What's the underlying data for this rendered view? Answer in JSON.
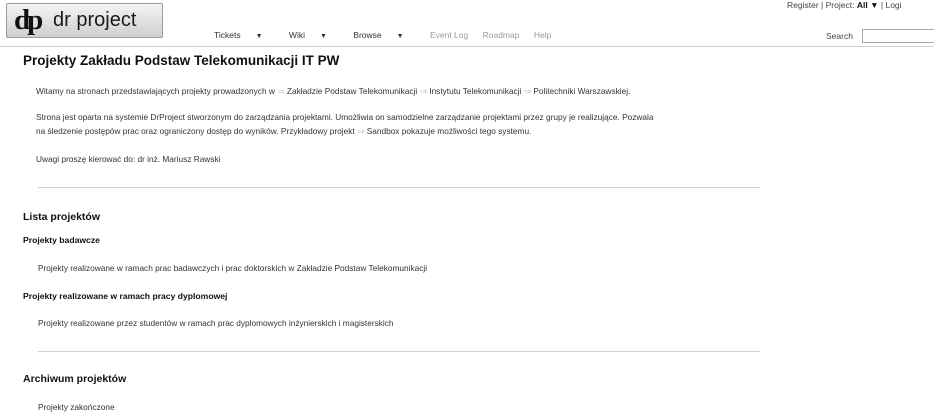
{
  "header": {
    "logo_mark": "dp",
    "logo_text": "dr project",
    "nav": [
      {
        "label": "Tickets",
        "dropdown": true
      },
      {
        "label": "Wiki",
        "dropdown": true
      },
      {
        "label": "Browse",
        "dropdown": true
      },
      {
        "label": "Event Log",
        "dropdown": false
      },
      {
        "label": "Roadmap",
        "dropdown": false
      },
      {
        "label": "Help",
        "dropdown": false
      }
    ],
    "register_label": "Register",
    "separator": "|",
    "project_label": "Project:",
    "project_value": "All",
    "login_label": "Logi",
    "search_label": "Search",
    "search_value": ""
  },
  "page": {
    "title": "Projekty Zakładu Podstaw Telekomunikacji IT PW",
    "intro": {
      "text_before": "Witamy na stronach przedstawiających projekty prowadzonych w",
      "link1": "Zakładzie Podstaw Telekomunikacji",
      "link2": "Instytutu Telekomunikacji",
      "link3": "Politechniki Warszawskiej."
    },
    "desc_line1": "Strona jest oparta na systemie DrProject stworzonym do zarządzania projektami. Umożliwia on samodzielne zarządzanie projektami przez grupy je realizujące. Pozwala",
    "desc_line2_before": "na śledzenie postępów prac oraz ograniczony dostęp do wyników. Przykładowy projekt",
    "desc_link": "Sandbox",
    "desc_line2_after": "pokazuje możliwości tego systemu.",
    "contact": "Uwagi proszę kierować do: dr inż. Mariusz Rawski",
    "projects_heading": "Lista projektów",
    "research_heading": "Projekty badawcze",
    "research_text": "Projekty realizowane w ramach prac badawczych i prac doktorskich w Zakładzie Podstaw Telekomunikacji",
    "diploma_heading": "Projekty realizowane w ramach pracy dyplomowej",
    "diploma_text": "Projekty realizowane przez studentów w ramach prac dyplomowych inżynierskich i magisterskich",
    "archive_heading": "Archiwum projektów",
    "archive_text": "Projekty zakończone"
  }
}
